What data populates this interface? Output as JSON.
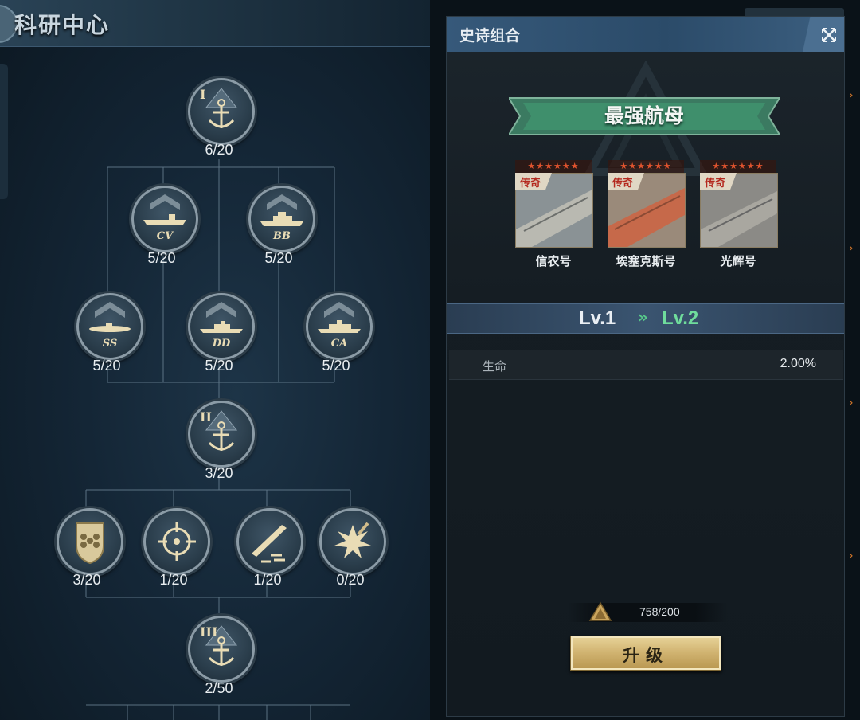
{
  "left": {
    "title": "科研中心",
    "tree": {
      "tier1": {
        "roman": "I",
        "count": "6/20"
      },
      "cv": {
        "label": "CV",
        "count": "5/20"
      },
      "bb": {
        "label": "BB",
        "count": "5/20"
      },
      "ss": {
        "label": "SS",
        "count": "5/20"
      },
      "dd": {
        "label": "DD",
        "count": "5/20"
      },
      "ca": {
        "label": "CA",
        "count": "5/20"
      },
      "tier2": {
        "roman": "II",
        "count": "3/20"
      },
      "shield": {
        "count": "3/20"
      },
      "target": {
        "count": "1/20"
      },
      "torpedo": {
        "count": "1/20"
      },
      "explosion": {
        "count": "0/20"
      },
      "tier3": {
        "roman": "III",
        "count": "2/50"
      }
    }
  },
  "panel": {
    "title": "史诗组合",
    "banner": "最强航母",
    "ships": [
      {
        "badge": "传奇",
        "stars": "★★★★★★",
        "name": "信农号"
      },
      {
        "badge": "传奇",
        "stars": "★★★★★★",
        "name": "埃塞克斯号"
      },
      {
        "badge": "传奇",
        "stars": "★★★★★★",
        "name": "光辉号"
      }
    ],
    "level": {
      "from": "Lv.1",
      "arrow": "»",
      "to": "Lv.2"
    },
    "stat": {
      "name": "生命",
      "value": "2.00%"
    },
    "cost": "758/200",
    "upgrade": "升级"
  },
  "colors": {
    "accent_green": "#6fdc9c",
    "button_gold": "#d2b573",
    "panel_header": "#36597a",
    "legend_red": "#b4281e"
  }
}
